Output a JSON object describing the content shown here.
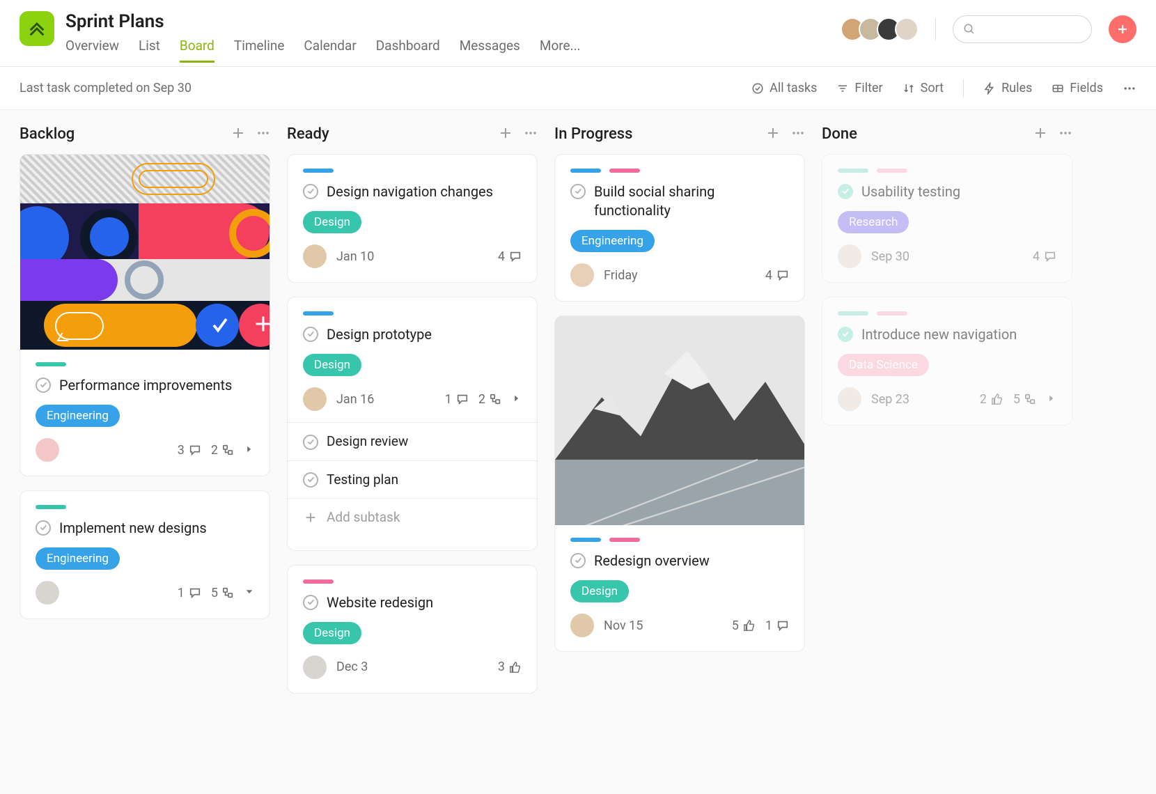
{
  "header": {
    "title": "Sprint Plans",
    "tabs": [
      "Overview",
      "List",
      "Board",
      "Timeline",
      "Calendar",
      "Dashboard",
      "Messages",
      "More..."
    ],
    "active_tab": 2,
    "search_placeholder": ""
  },
  "toolbar": {
    "status": "Last task completed on Sep 30",
    "all_tasks": "All tasks",
    "filter": "Filter",
    "sort": "Sort",
    "rules": "Rules",
    "fields": "Fields"
  },
  "columns": [
    {
      "title": "Backlog",
      "cards": [
        {
          "cover": "abstract",
          "bars": [
            "teal"
          ],
          "title": "Performance improvements",
          "tag": {
            "label": "Engineering",
            "cls": "tag-eng"
          },
          "avatar": "#f3c7c7",
          "date": "",
          "stats": {
            "comments": 3,
            "subtasks": 2,
            "caret": "right"
          }
        },
        {
          "bars": [
            "teal"
          ],
          "title": "Implement new designs",
          "tag": {
            "label": "Engineering",
            "cls": "tag-eng"
          },
          "avatar": "#d8d4d0",
          "date": "",
          "stats": {
            "comments": 1,
            "subtasks": 5,
            "caret": "down"
          }
        }
      ]
    },
    {
      "title": "Ready",
      "cards": [
        {
          "bars": [
            "blue"
          ],
          "title": "Design navigation changes",
          "tag": {
            "label": "Design",
            "cls": "tag-des"
          },
          "avatar": "#e0c8a8",
          "date": "Jan 10",
          "stats": {
            "comments": 4
          }
        },
        {
          "bars": [
            "blue"
          ],
          "title": "Design prototype",
          "tag": {
            "label": "Design",
            "cls": "tag-des"
          },
          "avatar": "#e0c8a8",
          "date": "Jan 16",
          "stats": {
            "comments": 1,
            "subtasks": 2,
            "caret": "right"
          },
          "subtasks": [
            "Design review",
            "Testing plan"
          ],
          "add_subtask": "Add subtask"
        },
        {
          "bars": [
            "pink"
          ],
          "title": "Website redesign",
          "tag": {
            "label": "Design",
            "cls": "tag-des"
          },
          "avatar": "#d8d4d0",
          "date": "Dec 3",
          "stats": {
            "likes": 3
          }
        }
      ]
    },
    {
      "title": "In Progress",
      "cards": [
        {
          "bars": [
            "blue",
            "pink"
          ],
          "title": "Build social sharing functionality",
          "tag": {
            "label": "Engineering",
            "cls": "tag-eng"
          },
          "avatar": "#e8d0b8",
          "date": "Friday",
          "stats": {
            "comments": 4
          }
        },
        {
          "cover": "mountain",
          "bars": [
            "blue",
            "pink"
          ],
          "title": "Redesign overview",
          "tag": {
            "label": "Design",
            "cls": "tag-des"
          },
          "avatar": "#e0c8a8",
          "date": "Nov 15",
          "stats": {
            "likes": 5,
            "comments": 1
          }
        }
      ]
    },
    {
      "title": "Done",
      "cards": [
        {
          "faded": true,
          "done": true,
          "bars": [
            "tealf",
            "pinkf"
          ],
          "title": "Usability testing",
          "tag": {
            "label": "Research",
            "cls": "tag-res"
          },
          "avatar": "#e8e0d8",
          "date": "Sep 30",
          "stats": {
            "comments": 4
          }
        },
        {
          "faded": true,
          "done": true,
          "bars": [
            "tealf",
            "pinkf"
          ],
          "title": "Introduce new navigation",
          "tag": {
            "label": "Data Science",
            "cls": "tag-ds"
          },
          "avatar": "#e8e0d8",
          "date": "Sep 23",
          "stats": {
            "likes": 2,
            "subtasks": 5,
            "caret": "right"
          }
        }
      ]
    }
  ]
}
